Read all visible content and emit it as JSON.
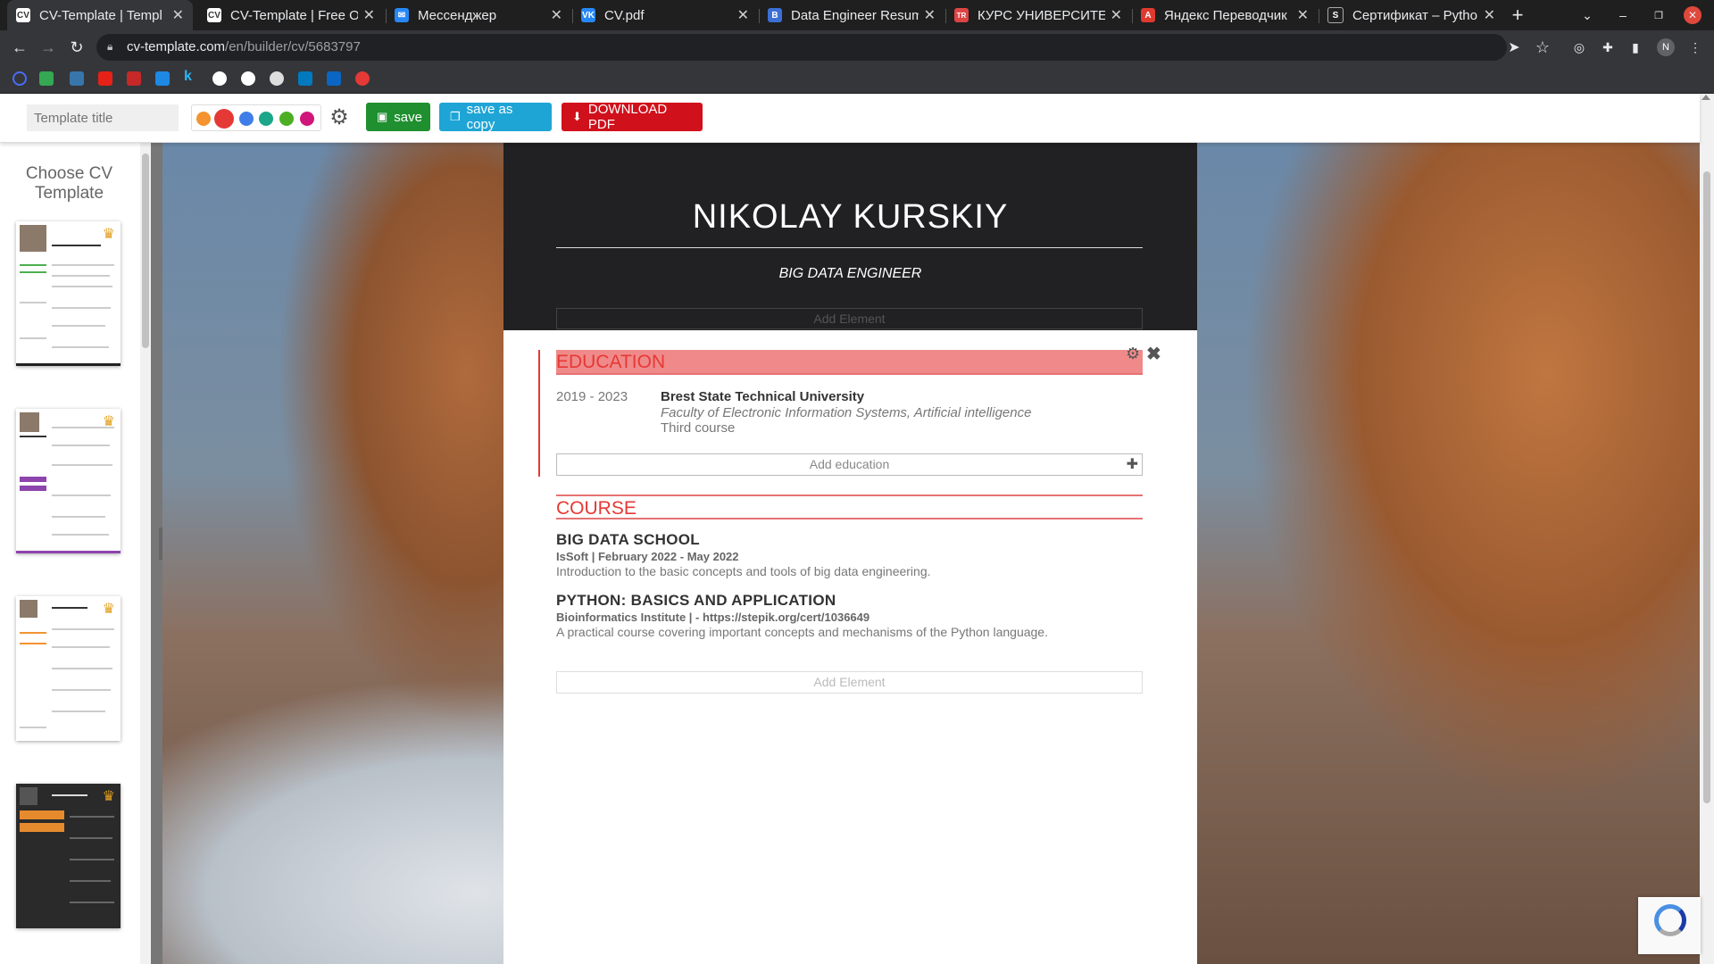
{
  "browser": {
    "tabs": [
      {
        "title": "CV-Template | Templ",
        "favicon": "cv-icon",
        "color": "#ffffff",
        "text": "CV"
      },
      {
        "title": "CV-Template | Free O",
        "favicon": "cv-icon",
        "color": "#ffffff",
        "text": "CV"
      },
      {
        "title": "Мессенджер",
        "favicon": "messenger-icon",
        "color": "#2787f5",
        "text": "✉"
      },
      {
        "title": "CV.pdf",
        "favicon": "vk-icon",
        "color": "#2787f5",
        "text": "VK"
      },
      {
        "title": "Data Engineer Resum",
        "favicon": "b-icon",
        "color": "#3b6fd6",
        "text": "B"
      },
      {
        "title": "КУРС УНИВЕРСИТЕТ",
        "favicon": "flag-icon",
        "color": "#d44",
        "text": "TR"
      },
      {
        "title": "Яндекс Переводчик",
        "favicon": "yandex-translate-icon",
        "color": "#e03a2f",
        "text": "A"
      },
      {
        "title": "Сертификат – Pytho",
        "favicon": "stepik-icon",
        "color": "#222",
        "text": "S"
      }
    ],
    "url_host": "cv-template.com",
    "url_path": "/en/builder/cv/5683797",
    "profile_initial": "N"
  },
  "toolbar": {
    "title_placeholder": "Template title",
    "colors": [
      "#f4932f",
      "#e53935",
      "#3f7ee8",
      "#1ba689",
      "#4caf23",
      "#d1167a"
    ],
    "selected_color": "#e53935",
    "save_label": "save",
    "save_copy_label": "save as copy",
    "download_label": "DOWNLOAD PDF",
    "save_color": "#1f8f2f",
    "save_copy_color": "#1ea5d6",
    "download_color": "#d0101b"
  },
  "sidebar": {
    "title": "Choose CV Template"
  },
  "cv": {
    "name": "NIKOLAY  KURSKIY",
    "role": "BIG DATA ENGINEER",
    "add_element": "Add Element",
    "education": {
      "title": "EDUCATION",
      "items": [
        {
          "years": "2019 - 2023",
          "university": "Brest State Technical University",
          "faculty": "Faculty of Electronic Information Systems, Artificial intelligence",
          "course": "Third course"
        }
      ],
      "add_label": "Add education"
    },
    "course": {
      "title": "COURSE",
      "items": [
        {
          "title": "BIG DATA SCHOOL",
          "meta": "IsSoft | February 2022 - May 2022",
          "desc": "Introduction to the basic concepts and tools of big data engineering."
        },
        {
          "title": "PYTHON: BASICS AND APPLICATION",
          "meta": "Bioinformatics Institute |  - https://stepik.org/cert/1036649",
          "desc": "A practical course covering important concepts and mechanisms of the Python language."
        }
      ]
    },
    "add_element_bottom": "Add Element"
  }
}
